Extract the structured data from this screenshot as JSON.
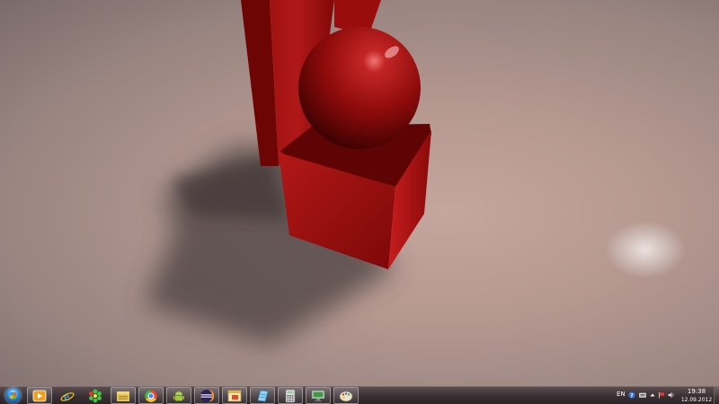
{
  "desktop": {
    "wallpaper": "3d-red-sphere-cube-render",
    "colors": {
      "scene_primary": "#9c0d0d",
      "background": "#b79a93"
    }
  },
  "taskbar": {
    "start_icon": "windows-start-orb",
    "pinned": [
      {
        "name": "windows-media-player",
        "icon": "media-player-icon"
      },
      {
        "name": "internet-explorer",
        "icon": "ie-icon"
      },
      {
        "name": "icq",
        "icon": "icq-flower-icon"
      },
      {
        "name": "windows-explorer",
        "icon": "folder-icon"
      },
      {
        "name": "google-chrome",
        "icon": "chrome-icon"
      },
      {
        "name": "android-sdk",
        "icon": "android-icon"
      },
      {
        "name": "eclipse",
        "icon": "eclipse-icon"
      },
      {
        "name": "sticky-app",
        "icon": "app-window-icon"
      },
      {
        "name": "notes-app",
        "icon": "notepad-icon"
      },
      {
        "name": "calculator",
        "icon": "calculator-icon"
      },
      {
        "name": "remote-desktop",
        "icon": "monitor-icon"
      },
      {
        "name": "paint",
        "icon": "paint-palette-icon"
      }
    ],
    "tray": {
      "language": "EN",
      "time": "19:38",
      "date": "12.09.2012"
    }
  }
}
